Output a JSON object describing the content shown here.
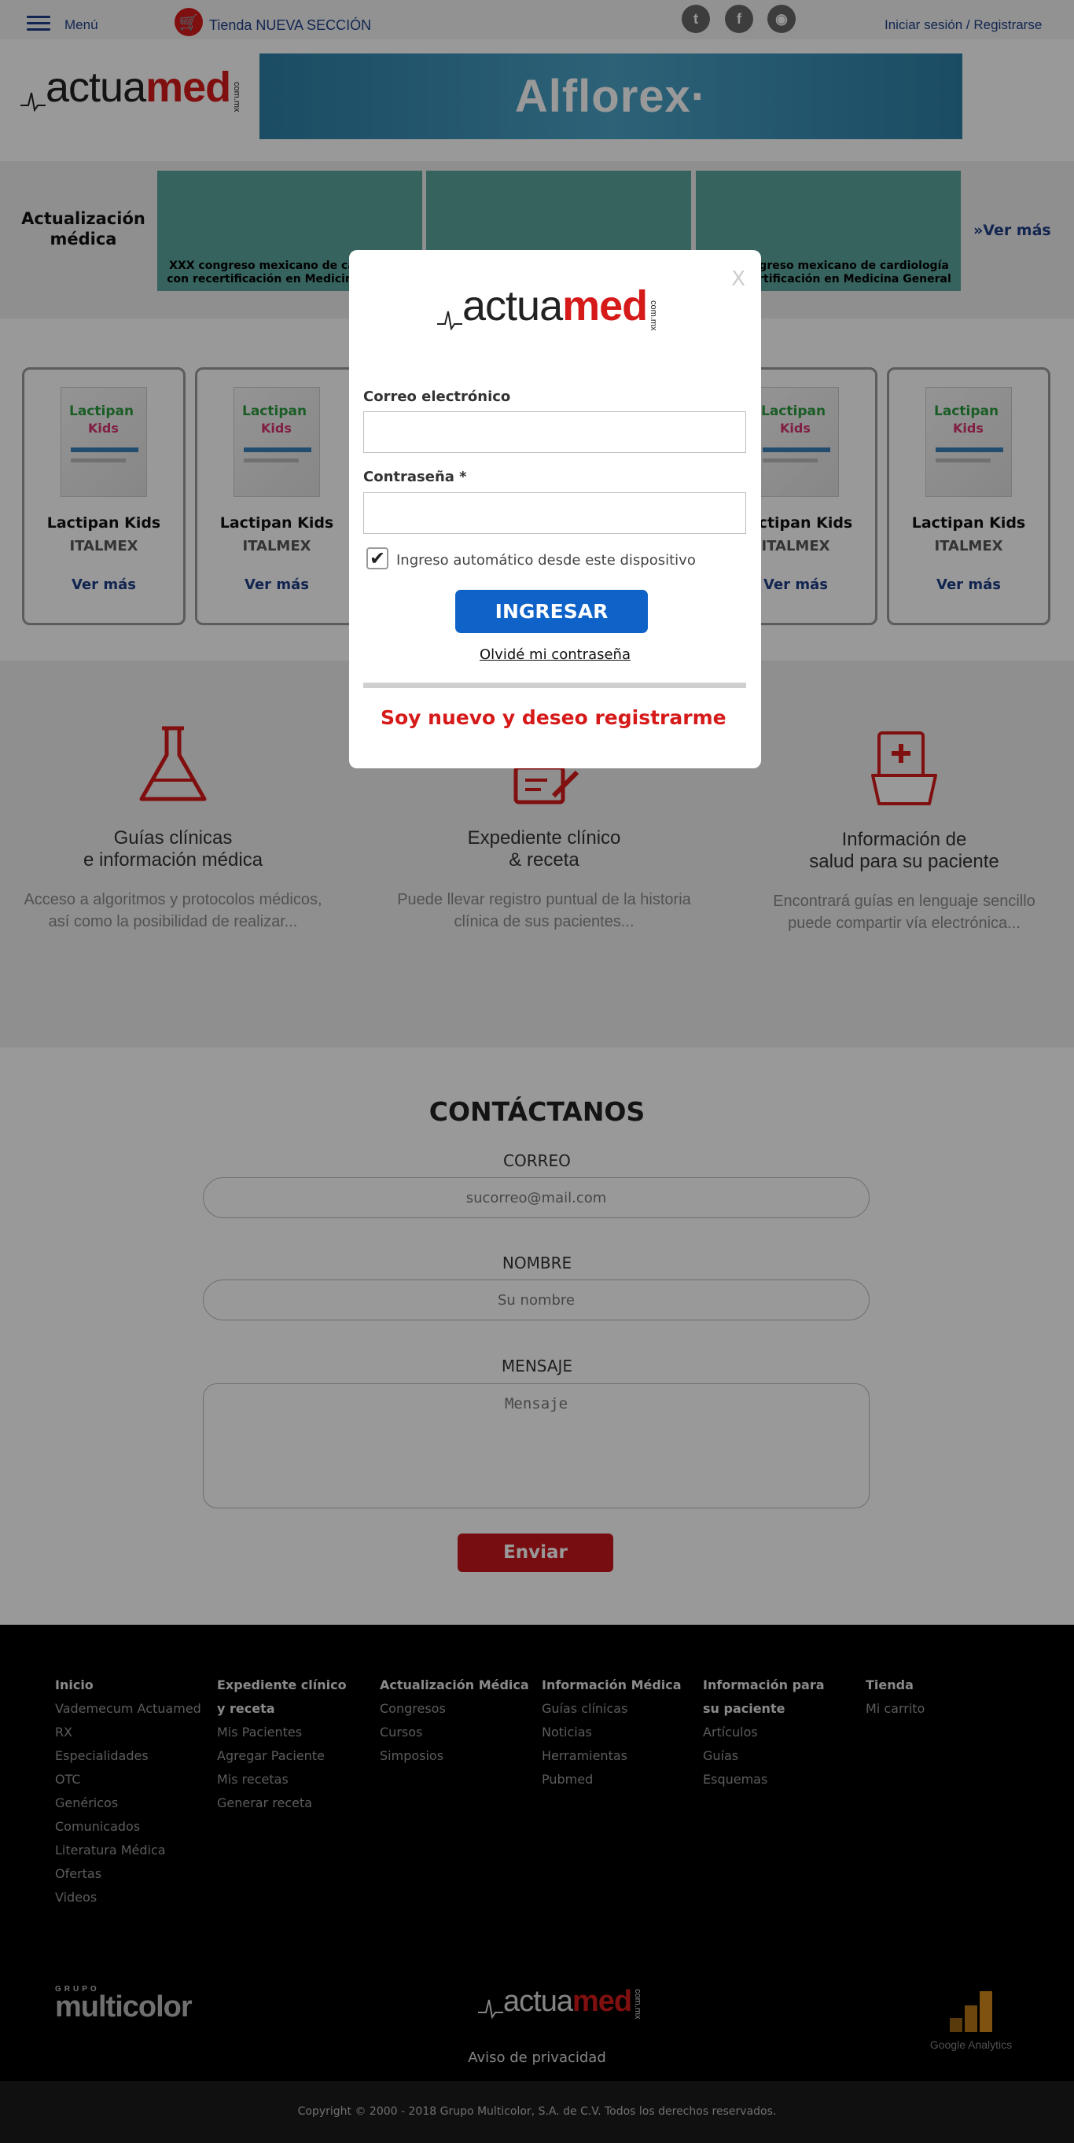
{
  "topbar": {
    "menu_label": "Menú",
    "tienda_label": "Tienda NUEVA SECCIÓN",
    "login_label": "Iniciar sesión / Registrarse",
    "social": [
      "twitter-icon",
      "facebook-icon",
      "instagram-icon"
    ]
  },
  "brand": {
    "actua": "actua",
    "med": "med",
    "com": "com.mx"
  },
  "ad": {
    "text": "Alflorex·"
  },
  "actualizacion": {
    "title": "Actualización médica",
    "cards": [
      "XXX congreso mexicano de cardiología con recertificación en Medicina General",
      "",
      "XXX congreso mexicano de cardiología con recertificación en Medicina General"
    ],
    "more": "»Ver más"
  },
  "products": [
    {
      "name": "Lactipan Kids",
      "brand": "ITALMEX",
      "more": "Ver más"
    },
    {
      "name": "Lactipan Kids",
      "brand": "ITALMEX",
      "more": "Ver más"
    },
    {
      "name": "Lactipan Kids",
      "brand": "ITALMEX",
      "more": "Ver más"
    },
    {
      "name": "Lactipan Kids",
      "brand": "ITALMEX",
      "more": "Ver más"
    }
  ],
  "product_box": {
    "line1": "Lactipan",
    "line2": "Kids"
  },
  "features": [
    {
      "title1": "Guías clínicas",
      "title2": "e información médica",
      "desc1": "Acceso a algoritmos y protocolos médicos,",
      "desc2": "así como la posibilidad de realizar..."
    },
    {
      "title1": "Expediente clínico",
      "title2": "& receta",
      "desc1": "Puede llevar registro puntual de la historia",
      "desc2": "clínica de sus pacientes..."
    },
    {
      "title1": "Información de",
      "title2": "salud para su paciente",
      "desc1": "Encontrará guías en lenguaje sencillo",
      "desc2": "puede compartir vía electrónica..."
    }
  ],
  "contact": {
    "title": "CONTÁCTANOS",
    "email_label": "CORREO",
    "email_placeholder": "sucorreo@mail.com",
    "name_label": "NOMBRE",
    "name_placeholder": "Su nombre",
    "message_label": "MENSAJE",
    "message_placeholder": "Mensaje",
    "send": "Enviar"
  },
  "footer": {
    "columns": [
      {
        "heading": "Inicio",
        "items": [
          "Vademecum Actuamed",
          "RX",
          "Especialidades",
          "OTC",
          "Genéricos",
          "Comunicados",
          "Literatura Médica",
          "Ofertas",
          "Videos"
        ]
      },
      {
        "heading": "Expediente clínico y receta",
        "items": [
          "Mis Pacientes",
          "Agregar Paciente",
          "Mis recetas",
          "Generar receta"
        ]
      },
      {
        "heading": "Actualización Médica",
        "items": [
          "Congresos",
          "Cursos",
          "Simposios"
        ]
      },
      {
        "heading": "Información Médica",
        "items": [
          "Guías clínicas",
          "Noticias",
          "Herramientas",
          "Pubmed"
        ]
      },
      {
        "heading": "Información para su paciente",
        "items": [
          "Artículos",
          "Guías",
          "Esquemas"
        ]
      },
      {
        "heading": "Tienda",
        "items": [
          "Mi carrito"
        ]
      }
    ],
    "multicolor_small": "GRUPO",
    "multicolor": "multicolor",
    "privacy": "Aviso de privacidad",
    "ga_label": "Google Analytics",
    "copyright": "Copyright © 2000 - 2018 Grupo Multicolor, S.A. de C.V. Todos los derechos reservados."
  },
  "modal": {
    "close": "X",
    "email_label": "Correo electrónico",
    "password_label": "Contraseña *",
    "remember_label": "Ingreso automático desde este dispositivo",
    "remember_checked": true,
    "submit": "INGRESAR",
    "forgot": "Olvidé mi contraseña",
    "register": "Soy nuevo y deseo registrarme"
  }
}
